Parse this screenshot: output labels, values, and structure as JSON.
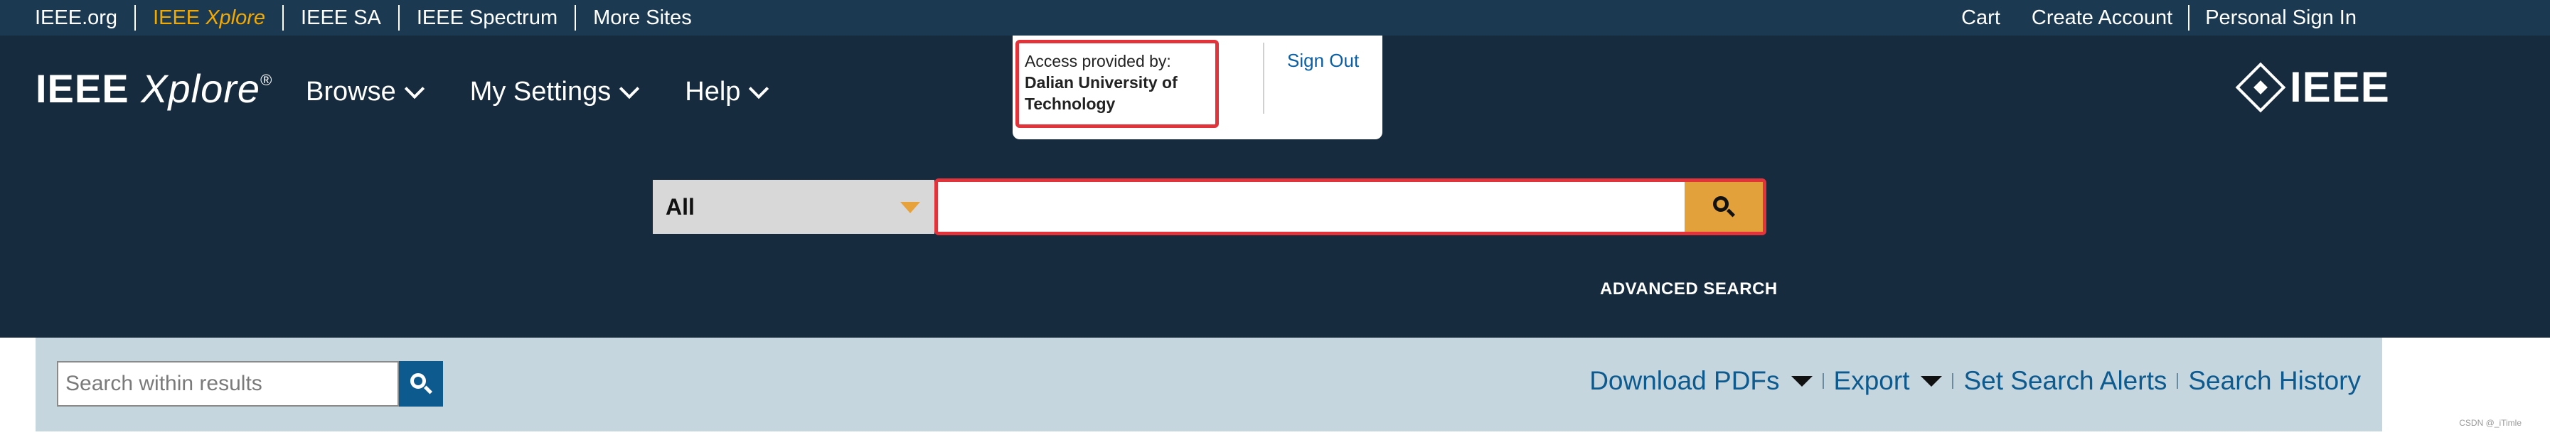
{
  "topbar": {
    "links": [
      "IEEE.org",
      "IEEE",
      "IEEE SA",
      "IEEE Spectrum",
      "More Sites"
    ],
    "xplore_link": {
      "prefix": "IEEE",
      "suffix": "Xplore"
    },
    "right_links": [
      "Cart",
      "Create Account",
      "Personal Sign In"
    ]
  },
  "header": {
    "logo": {
      "prefix": "IEEE",
      "suffix": "Xplore",
      "mark": "®"
    },
    "nav": [
      "Browse",
      "My Settings",
      "Help"
    ],
    "access": {
      "label": "Access provided by:",
      "institution": "Dalian University of Technology",
      "sign_out": "Sign Out"
    },
    "brand": "IEEE"
  },
  "search": {
    "scope": "All",
    "value": "",
    "advanced_label": "ADVANCED SEARCH"
  },
  "results_bar": {
    "within_placeholder": "Search within results",
    "download_pdfs": "Download PDFs",
    "export": "Export",
    "set_search_alerts": "Set Search Alerts",
    "search_history": "Search History"
  },
  "watermark": "CSDN @_iTimle",
  "colors": {
    "topbar_bg": "#1b3a52",
    "header_bg": "#162b3d",
    "accent_orange": "#e2a13a",
    "highlight_red": "#e2333b",
    "link_blue": "#0d5a8f",
    "results_bar_bg": "#c5d6df"
  }
}
